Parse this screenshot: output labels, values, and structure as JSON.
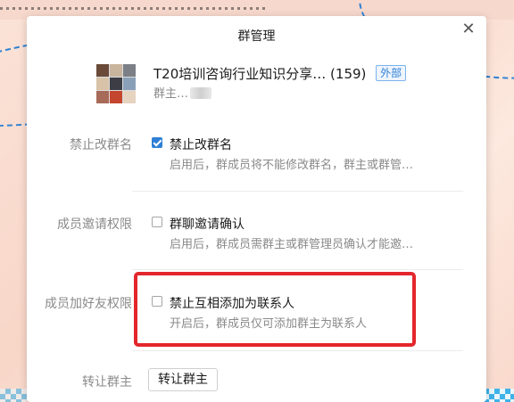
{
  "dialog": {
    "title": "群管理",
    "close_icon": "close-icon"
  },
  "group": {
    "name": "T20培训咨询行业知识分享…",
    "member_count": "(159)",
    "external_badge": "外部",
    "owner_prefix": "群主…"
  },
  "settings": [
    {
      "label": "禁止改群名",
      "option": "禁止改群名",
      "description": "启用后，群成员将不能修改群名，群主或群管…",
      "checked": true
    },
    {
      "label": "成员邀请权限",
      "option": "群聊邀请确认",
      "description": "启用后，群成员需群主或群管理员确认才能邀…",
      "checked": false
    },
    {
      "label": "成员加好友权限",
      "option": "禁止互相添加为联系人",
      "description": "开启后，群成员仅可添加群主为联系人",
      "checked": false
    }
  ],
  "transfer": {
    "label": "转让群主",
    "button": "转让群主"
  },
  "colors": {
    "accent": "#2f7fd6",
    "highlight": "#e3262b"
  }
}
